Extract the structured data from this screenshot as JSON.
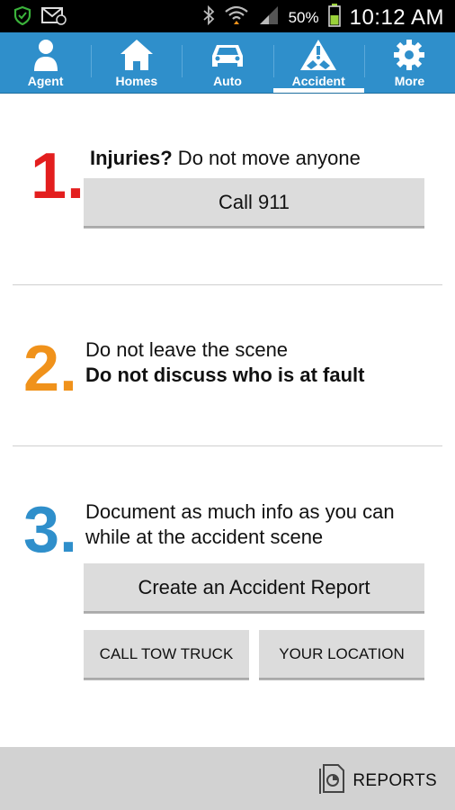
{
  "status_bar": {
    "battery_percent": "50%",
    "time": "10:12 AM"
  },
  "nav": {
    "tabs": [
      {
        "label": "Agent",
        "icon": "agent-person-icon"
      },
      {
        "label": "Homes",
        "icon": "house-icon"
      },
      {
        "label": "Auto",
        "icon": "car-icon"
      },
      {
        "label": "Accident",
        "icon": "accident-warning-icon",
        "active": true
      },
      {
        "label": "More",
        "icon": "gear-icon"
      }
    ],
    "color": "#2f8fcb"
  },
  "steps": [
    {
      "number": "1.",
      "color": "#e31e1e",
      "bold_text": "Injuries?",
      "text": " Do not move anyone",
      "button": "Call 911"
    },
    {
      "number": "2.",
      "color": "#f0921b",
      "line1": "Do not leave the scene",
      "line2_bold": "Do not discuss who is at fault"
    },
    {
      "number": "3.",
      "color": "#2f8fcb",
      "line1": "Document as much info as you can",
      "line2": "while at the accident scene",
      "button": "Create an Accident Report",
      "button_tow": "CALL TOW TRUCK",
      "button_location": "YOUR LOCATION"
    }
  ],
  "bottom": {
    "reports_label": "REPORTS",
    "reports_icon": "reports-document-icon"
  }
}
